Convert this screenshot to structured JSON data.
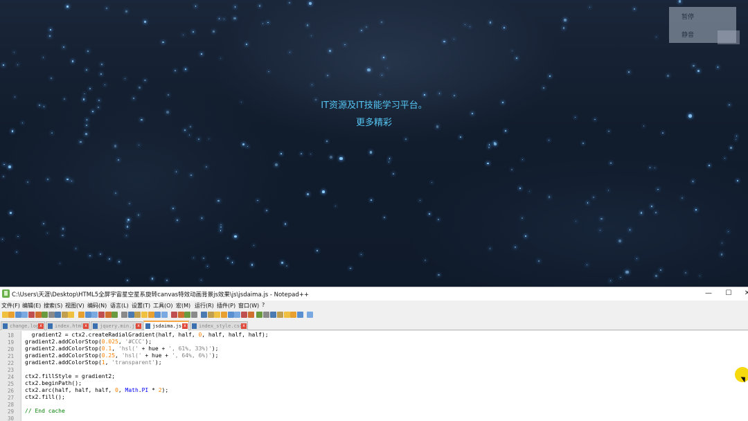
{
  "page": {
    "hero_title": "IT资源及IT技能学习平台。",
    "hero_subtitle": "更多精彩",
    "controls": {
      "pause": "暂停",
      "mute": "静音"
    }
  },
  "window": {
    "title": "C:\\Users\\天涯\\Desktop\\HTML5全屏宇宙星空星系旋转canvas特效动画背景js效果\\js\\jsdaima.js - Notepad++",
    "buttons": {
      "minimize": "—",
      "maximize": "☐",
      "close": "✕"
    }
  },
  "menu": [
    "文件(F)",
    "编辑(E)",
    "搜索(S)",
    "视图(V)",
    "编码(N)",
    "语言(L)",
    "设置(T)",
    "工具(O)",
    "宏(M)",
    "运行(R)",
    "插件(P)",
    "窗口(W)",
    "?"
  ],
  "tabs": [
    {
      "label": "change.log",
      "active": false
    },
    {
      "label": "index.html",
      "active": false
    },
    {
      "label": "jquery.min.js",
      "active": false
    },
    {
      "label": "jsdaima.js",
      "active": true
    },
    {
      "label": "index_style.css",
      "active": false
    }
  ],
  "editor": {
    "line_numbers": [
      "18",
      "19",
      "20",
      "21",
      "22",
      "23",
      "24",
      "25",
      "26",
      "27",
      "28",
      "29",
      "30"
    ],
    "lines": {
      "l18": {
        "a": "  gradient2 = ctx2.createRadialGradient(half, half, ",
        "b": "0",
        "c": ", half, half, half);"
      },
      "l19": {
        "a": "gradient2.addColorStop(",
        "b": "0.025",
        "c": ", ",
        "d": "'#CCC'",
        "e": ");"
      },
      "l20": {
        "a": "gradient2.addColorStop(",
        "b": "0.1",
        "c": ", ",
        "d": "'hsl('",
        "e": " + hue + ",
        "f": "', 61%, 33%)'",
        "g": ");"
      },
      "l21": {
        "a": "gradient2.addColorStop(",
        "b": "0.25",
        "c": ", ",
        "d": "'hsl('",
        "e": " + hue + ",
        "f": "', 64%, 6%)'",
        "g": ");"
      },
      "l22": {
        "a": "gradient2.addColorStop(",
        "b": "1",
        "c": ", ",
        "d": "'transparent'",
        "e": ");"
      },
      "l24": {
        "a": "ctx2.fillStyle = gradient2;"
      },
      "l25": {
        "a": "ctx2.beginPath();"
      },
      "l26": {
        "a": "ctx2.arc(half, half, half, ",
        "b": "0",
        "c": ", ",
        "d": "Math",
        "e": ".",
        "f": "PI",
        "g": " * ",
        "h": "2",
        "i": ");"
      },
      "l27": {
        "a": "ctx2.fill();"
      },
      "l29": {
        "a": "// End cache"
      }
    }
  },
  "colors": {
    "hero_text": "#55c4f2",
    "active_tab_accent": "#f7a844",
    "cursor_highlight": "#f5d800"
  }
}
